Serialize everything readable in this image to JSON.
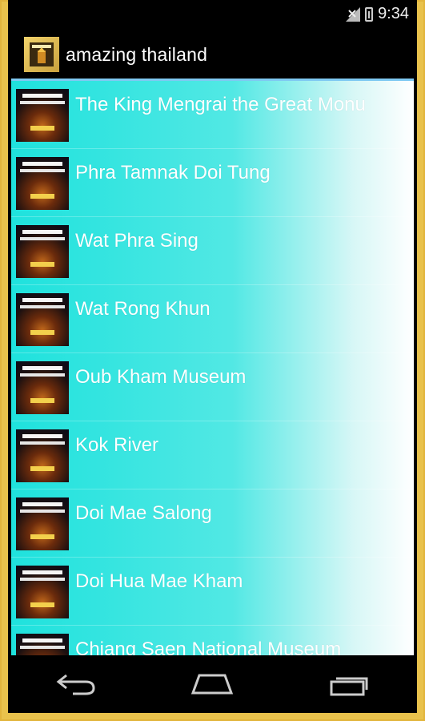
{
  "status_bar": {
    "time": "9:34"
  },
  "action_bar": {
    "title": "amazing thailand",
    "icon": "app-logo-icon"
  },
  "list": {
    "items": [
      {
        "label": "The King Mengrai the Great Monu"
      },
      {
        "label": "Phra Tamnak Doi Tung"
      },
      {
        "label": "Wat Phra Sing"
      },
      {
        "label": "Wat Rong Khun"
      },
      {
        "label": "Oub Kham Museum"
      },
      {
        "label": "Kok River"
      },
      {
        "label": "Doi Mae Salong"
      },
      {
        "label": "Doi Hua Mae Kham"
      },
      {
        "label": "Chiang Saen National Museum"
      }
    ]
  },
  "nav_bar": {
    "buttons": [
      "back-icon",
      "home-icon",
      "recent-apps-icon"
    ]
  },
  "colors": {
    "list_gradient_start": "#1fe2dd",
    "list_gradient_end": "#ffffff",
    "frame": "#e9c24c"
  }
}
